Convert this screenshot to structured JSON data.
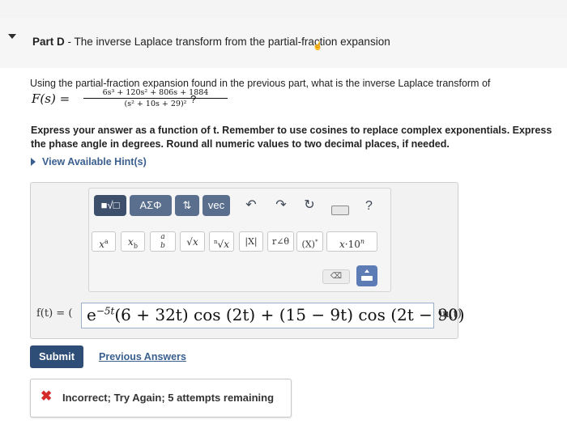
{
  "header": {
    "part": "Part D",
    "title": " - The inverse Laplace transform from the partial-fraction expansion"
  },
  "question": {
    "text": "Using the partial-fraction expansion found in the previous part, what is the inverse Laplace transform of",
    "lhs": "F(s) =",
    "numerator": "6s³ + 120s² + 806s + 1884",
    "denominator": "(s² + 10s + 29)²",
    "trailing": "?"
  },
  "instructions": "Express your answer as a function of t. Remember to use cosines to replace complex exponentials. Express the phase angle in degrees. Round all numeric values to two decimal places, if needed.",
  "hints": {
    "label": "View Available Hint(s)"
  },
  "toolbar": {
    "row1": [
      {
        "name": "templates-button",
        "label": "■√□"
      },
      {
        "name": "greek-symbols-button",
        "label": "ΑΣΦ"
      },
      {
        "name": "arrows-button",
        "label": "⇅"
      },
      {
        "name": "vec-button",
        "label": "vec"
      },
      {
        "name": "undo-icon",
        "label": "↶"
      },
      {
        "name": "redo-icon",
        "label": "↷"
      },
      {
        "name": "reset-icon",
        "label": "↻"
      },
      {
        "name": "keyboard-icon",
        "label": ""
      },
      {
        "name": "help-icon",
        "label": "?"
      }
    ],
    "row2": [
      {
        "name": "superscript-button",
        "label": "xᵃ"
      },
      {
        "name": "subscript-button",
        "label": "x_b"
      },
      {
        "name": "fraction-button",
        "label": "a/b"
      },
      {
        "name": "sqrt-button",
        "label": "√x"
      },
      {
        "name": "nth-root-button",
        "label": "ⁿ√x"
      },
      {
        "name": "abs-button",
        "label": "|x|"
      },
      {
        "name": "polar-button",
        "label": "r∠θ"
      },
      {
        "name": "conjugate-button",
        "label": "(X)*"
      },
      {
        "name": "sci-notation-button",
        "label": "x·10ⁿ"
      }
    ],
    "delete_label": "⌫",
    "keyboard_label": ""
  },
  "answer": {
    "label": "f(t) = (",
    "exp_base": "e",
    "exp_power": "−5t",
    "body": "(6 + 32t) cos (2t) + (15 − 9t) cos (2t − 90)",
    "suffix": ")u(t)"
  },
  "actions": {
    "submit": "Submit",
    "previous": "Previous Answers"
  },
  "feedback": {
    "icon": "✖",
    "text": "Incorrect; Try Again; 5 attempts remaining",
    "status_color": "#d42a2a"
  },
  "colors": {
    "accent": "#2e4e78",
    "link": "#3a5f8f",
    "toolbar_button": "#5a6f8e"
  }
}
